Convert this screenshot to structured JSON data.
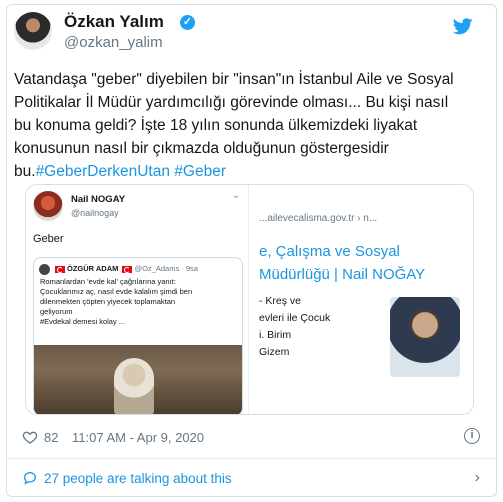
{
  "author": {
    "name": "Özkan Yalım",
    "handle": "@ozkan_yalim"
  },
  "tweet": {
    "line1": "Vatandaşa \"geber\" diyebilen bir \"insan\"ın İstanbul Aile ve Sosyal",
    "line2": "Politikalar İl Müdür yardımcılığı görevinde olması... Bu kişi nasıl",
    "line3": "bu konuma geldi? İşte 18 yılın sonunda ülkemizdeki liyakat",
    "line4": "konusunun nasıl bir çıkmazda olduğunun göstergesidir",
    "line5_prefix": "bu.",
    "hashtag1": "#GeberDerkenUtan",
    "hashtag2": "#Geber"
  },
  "embedded": {
    "name": "Nail NOGAY",
    "handle": "@nailnogay",
    "text": "Geber",
    "quote": {
      "name": "ÖZGÜR ADAM",
      "handle_time": "@Oz_Adams · 9sa",
      "line1": "Romanlardan 'evde kal' çağrılarına yanıt:",
      "line2": "Çocuklarımız aç, nasıl evde kalalım şimdi ben",
      "line3": "dilenmekten çöpten yiyecek toplamaktan",
      "line4": "geliyorum",
      "line5": "#Evdekal demesi kolay ..."
    }
  },
  "search_result": {
    "url": "...ailevecalisma.gov.tr › n...",
    "title_line1": "e, Çalışma ve Sosyal",
    "title_line2": "Müdürlüğü | Nail NOĞAY",
    "snippet1": "- Kreş ve",
    "snippet2": "evleri ile Çocuk",
    "snippet3": "i. Birim",
    "snippet4": "Gizem"
  },
  "meta": {
    "likes": "82",
    "timestamp": "11:07 AM - Apr 9, 2020"
  },
  "footer": {
    "talking": "27 people are talking about this"
  },
  "colors": {
    "accent": "#1da1f2",
    "link": "#1b95e0",
    "muted": "#657786"
  }
}
